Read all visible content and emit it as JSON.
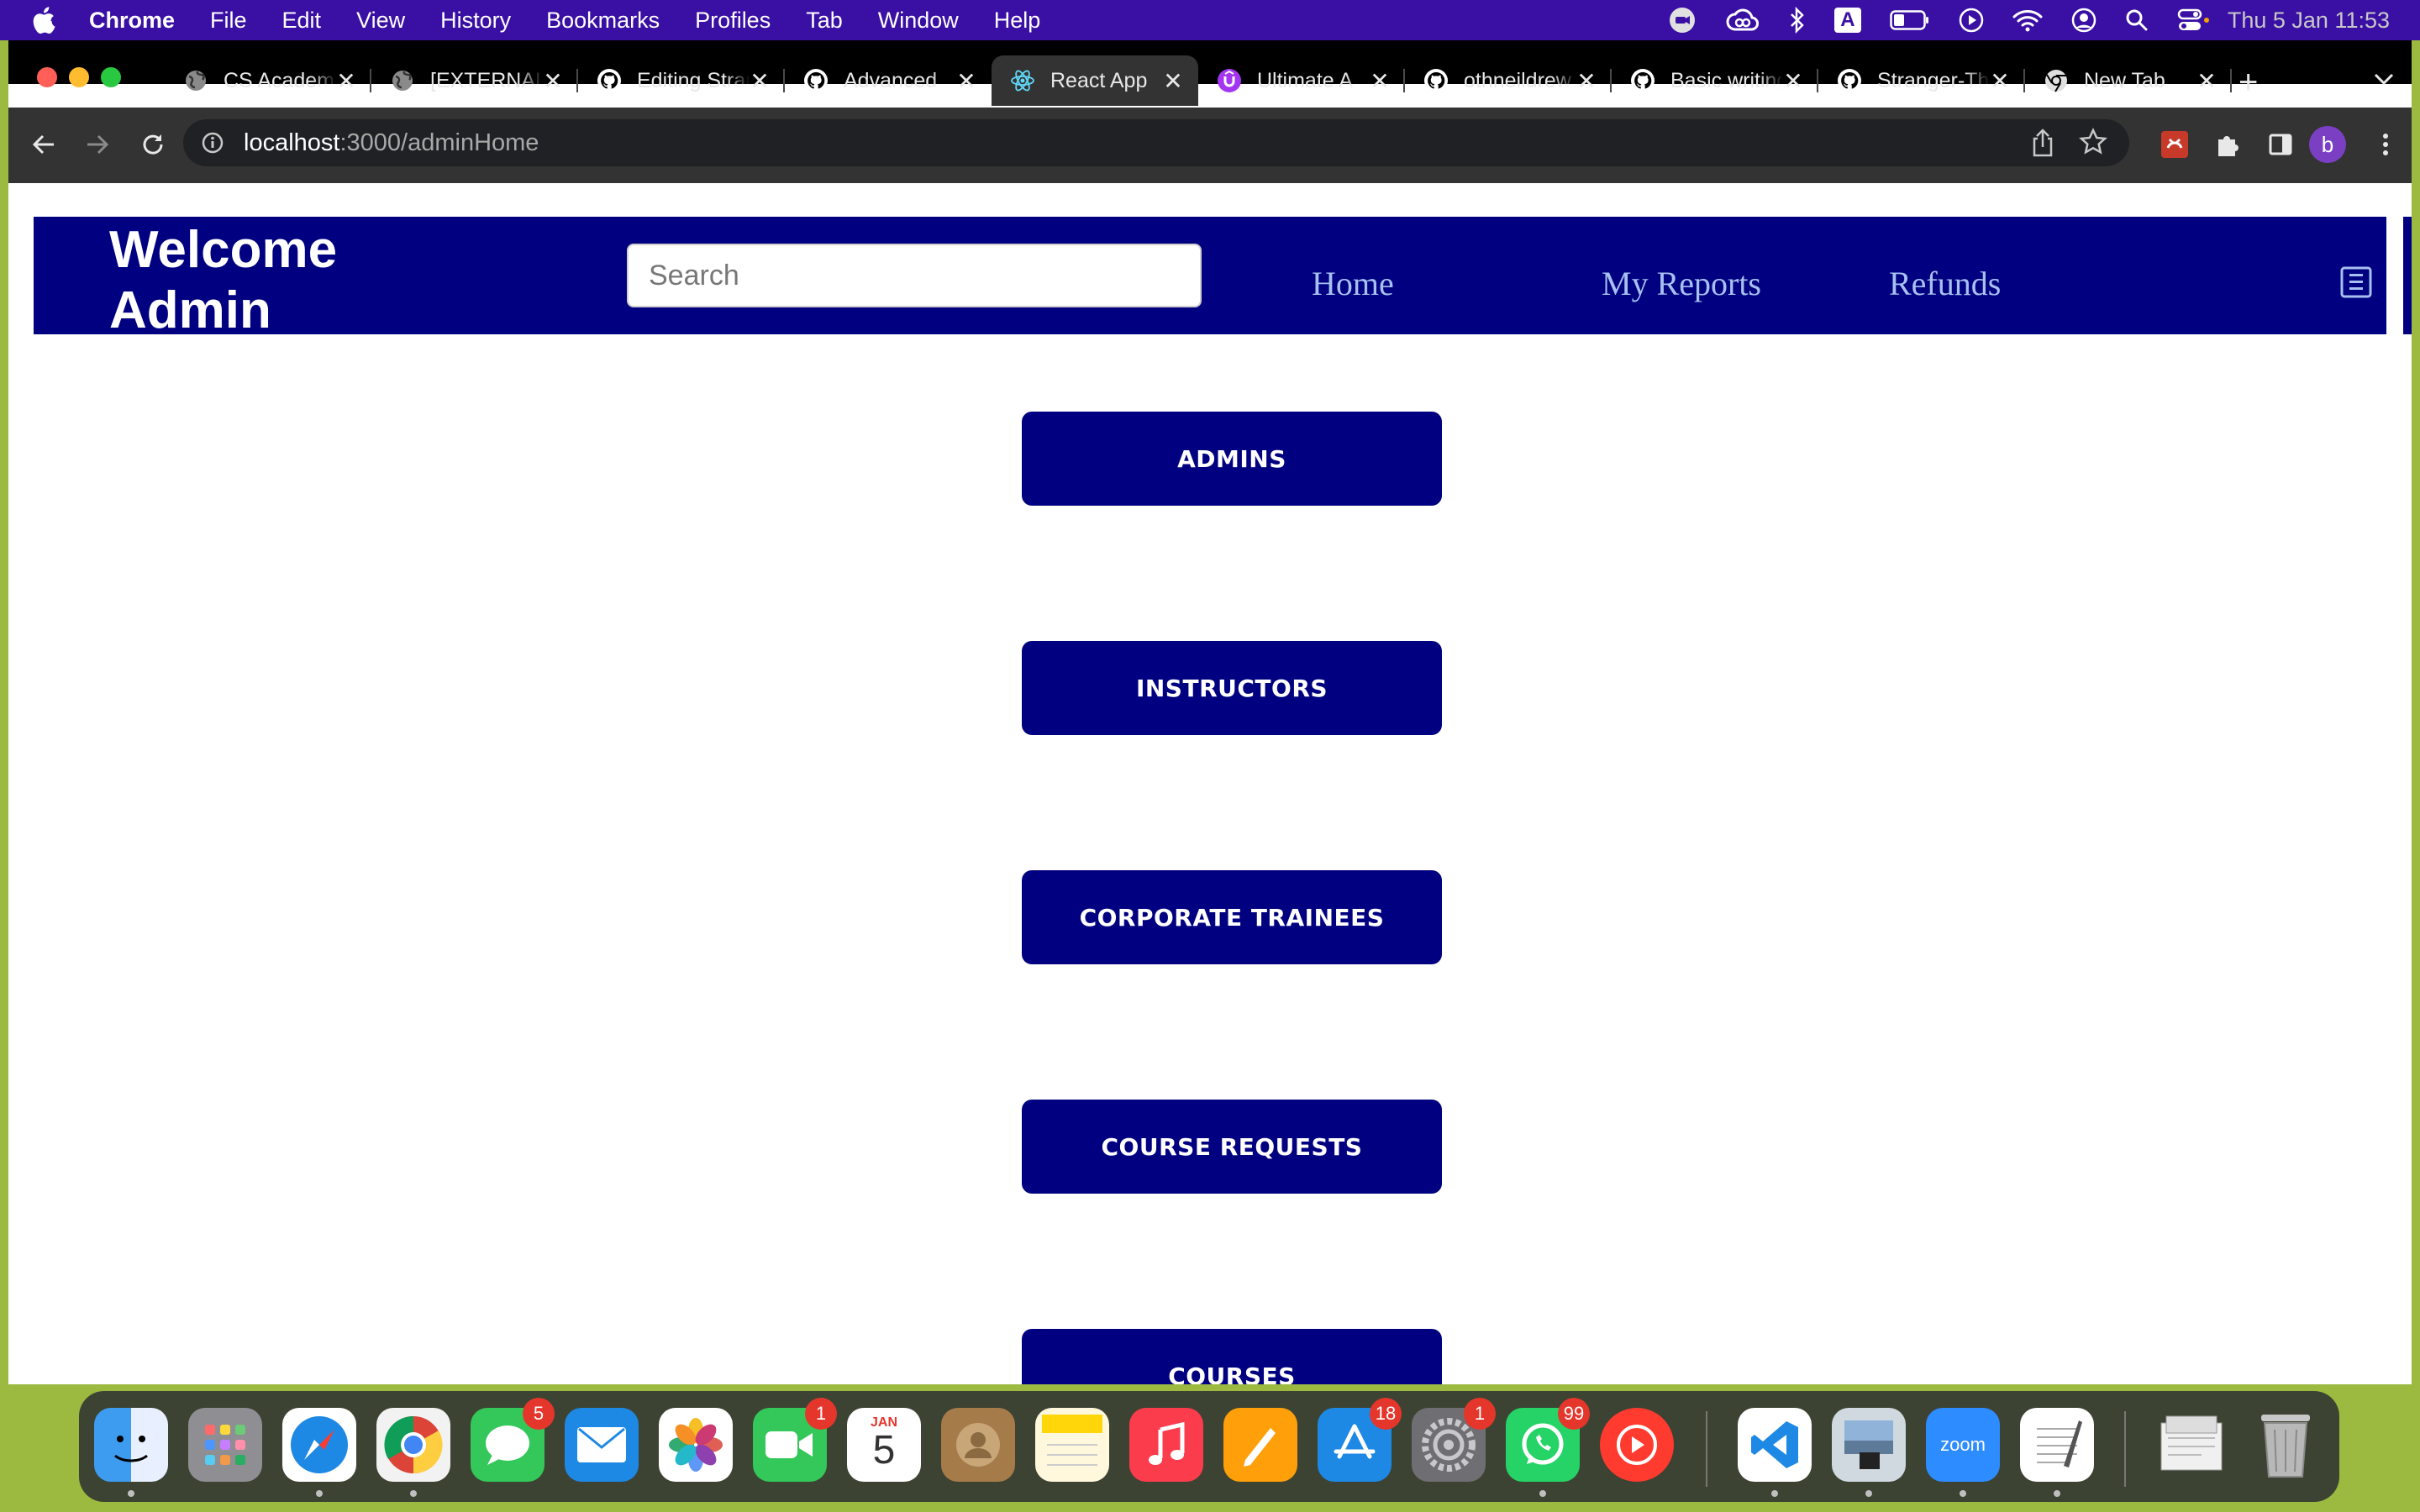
{
  "menubar": {
    "app_name": "Chrome",
    "items": [
      "File",
      "Edit",
      "View",
      "History",
      "Bookmarks",
      "Profiles",
      "Tab",
      "Window",
      "Help"
    ],
    "clock": "Thu 5 Jan  11:53",
    "input_source": "A"
  },
  "browser": {
    "tabs": [
      {
        "title": "CS Academy",
        "icon": "globe-icon"
      },
      {
        "title": "[EXTERNAL]",
        "icon": "globe-icon"
      },
      {
        "title": "Editing Stranger",
        "icon": "github-icon"
      },
      {
        "title": "Advanced",
        "icon": "github-icon"
      },
      {
        "title": "React App",
        "icon": "react-icon",
        "active": true
      },
      {
        "title": "Ultimate A",
        "icon": "udemy-icon"
      },
      {
        "title": "othneildrew",
        "icon": "github-icon"
      },
      {
        "title": "Basic writing",
        "icon": "github-icon"
      },
      {
        "title": "Stranger-Things",
        "icon": "github-icon"
      },
      {
        "title": "New Tab",
        "icon": "chrome-icon"
      }
    ],
    "close_glyph": "✕",
    "new_tab_glyph": "+",
    "url_host": "localhost",
    "url_path": ":3000/adminHome",
    "profile_initial": "b"
  },
  "page": {
    "welcome": "Welcome Admin",
    "search_placeholder": "Search",
    "nav": {
      "home": "Home",
      "reports": "My Reports",
      "refunds": "Refunds"
    },
    "buttons": [
      "ADMINS",
      "INSTRUCTORS",
      "CORPORATE TRAINEES",
      "COURSE REQUESTS",
      "COURSES"
    ],
    "colors": {
      "navy": "#000080",
      "nav_link": "#a8c0f0"
    }
  },
  "dock": {
    "badges": {
      "messages": "5",
      "facetime": "1",
      "appstore": "18",
      "settings": "1",
      "whatsapp": "99"
    },
    "calendar": {
      "month": "JAN",
      "day": "5"
    },
    "zoom_label": "zoom"
  }
}
